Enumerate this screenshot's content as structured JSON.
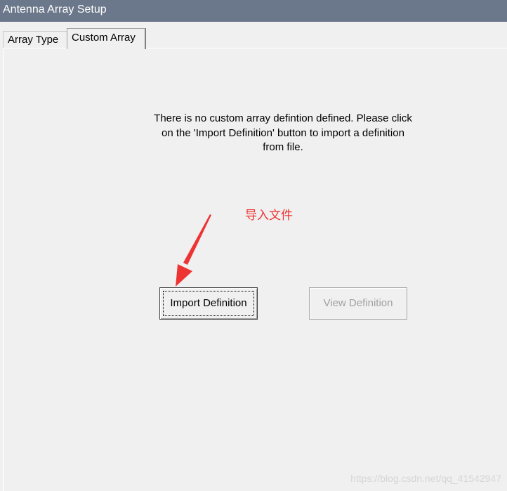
{
  "window": {
    "title": "Antenna Array Setup"
  },
  "tabs": [
    {
      "label": "Array Type",
      "active": false
    },
    {
      "label": "Custom Array",
      "active": true
    }
  ],
  "panel": {
    "message": "There is no custom array defintion defined. Please click on the 'Import Definition' button to import a definition from file.",
    "annotation": "导入文件",
    "annotation_color": "#ee3333",
    "buttons": {
      "import_label": "Import Definition",
      "view_label": "View Definition",
      "view_enabled": false
    }
  },
  "watermark": "https://blog.csdn.net/qq_41542947"
}
